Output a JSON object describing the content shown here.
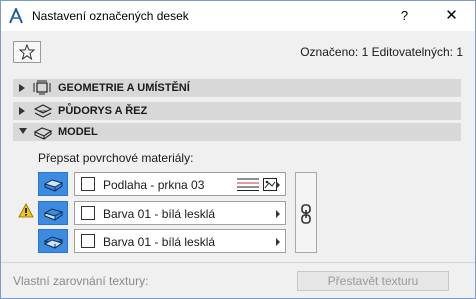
{
  "window": {
    "title": "Nastavení označených desek",
    "help_label": "?",
    "close_label": "✕"
  },
  "header": {
    "favorites_icon": "star-icon",
    "marked_text": "Označeno: 1 Editovatelných: 1"
  },
  "sections": [
    {
      "label": "GEOMETRIE A UMÍSTĚNÍ",
      "icon": "geometry-icon",
      "expanded": false
    },
    {
      "label": "PŮDORYS A ŘEZ",
      "icon": "floorplan-icon",
      "expanded": false
    },
    {
      "label": "MODEL",
      "icon": "model-icon",
      "expanded": true
    }
  ],
  "model": {
    "override_label": "Přepsat povrchové materiály:",
    "warning_icon": "warning-icon",
    "materials": [
      {
        "surface_icon": "top-surface-icon",
        "name": "Podlaha - prkna 03",
        "show_extra_icons": true
      },
      {
        "surface_icon": "side-surface-icon",
        "name": "Barva 01 - bílá lesklá",
        "show_extra_icons": false
      },
      {
        "surface_icon": "bottom-surface-icon",
        "name": "Barva 01 - bílá lesklá",
        "show_extra_icons": false
      }
    ],
    "link_icon": "chain-link-icon"
  },
  "footer": {
    "texture_alignment_label": "Vlastní zarovnání textury:",
    "rebuild_texture_label": "Přestavět texturu"
  },
  "colors": {
    "accent_blue": "#3d8be0",
    "section_bg": "#d8d8d8",
    "warning_yellow": "#f5c518"
  }
}
